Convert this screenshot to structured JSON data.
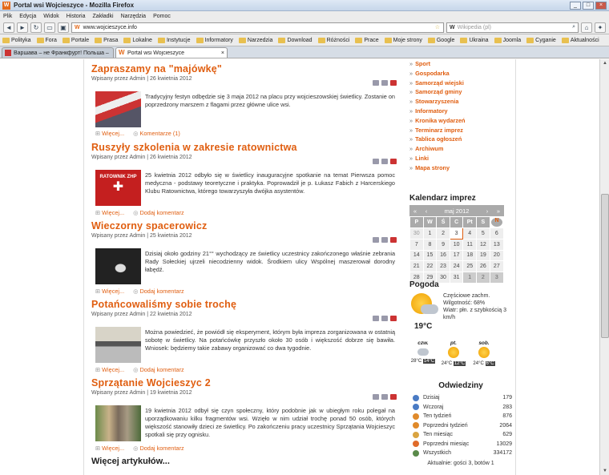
{
  "window": {
    "title": "Portal wsi Wojcieszyce - Mozilla Firefox",
    "minimize": "_",
    "maximize": "□",
    "close": "×"
  },
  "menu": [
    "Plik",
    "Edycja",
    "Widok",
    "Historia",
    "Zakładki",
    "Narzędzia",
    "Pomoc"
  ],
  "nav": {
    "back": "◄",
    "forward": "►",
    "reload": "↻",
    "home": "⌂",
    "url": "www.wojcieszyce.info",
    "search_placeholder": "Wikipedia (pl)",
    "search_engine": "W"
  },
  "bookmarks": [
    "Polityka",
    "Fora",
    "Portale",
    "Prasa",
    "Lokalne",
    "Instytucje",
    "Informatory",
    "Narzedzia",
    "Download",
    "Różności",
    "Prace",
    "Moje strony",
    "Google",
    "Ukraina",
    "Joomla",
    "Cyganie",
    "Aktualności"
  ],
  "tabs": [
    {
      "label": "Варшава – не Франкфурт! Польша – н...",
      "active": false
    },
    {
      "label": "Portal wsi Wojcieszyce",
      "active": true
    }
  ],
  "articles": [
    {
      "title": "Zapraszamy na \"majówkę\"",
      "meta": "Wpisany przez Admin | 26 kwietnia 2012",
      "body": "Tradycyjny festyn odbędzie się 3 maja 2012 na placu przy wojcieszowskiej świetlicy. Zostanie on poprzedzony marszem z flagami przez główne ulice wsi.",
      "more": "Więcej...",
      "comments": "Komentarze (1)"
    },
    {
      "title": "Ruszyły szkolenia w zakresie ratownictwa",
      "meta": "Wpisany przez Admin | 26 kwietnia 2012",
      "body": "25 kwietnia 2012 odbyło się w świetlicy inauguracyjne spotkanie na temat Pierwsza pomoc medyczna - podstawy teoretyczne i praktyka. Poprowadził je p. Łukasz Fabich z Harcerskiego Klubu Ratownictwa, którego towarzyszyła dwójka asystentów.",
      "more": "Więcej...",
      "comments": "Dodaj komentarz",
      "img_text": "RATOWNIK ZHP"
    },
    {
      "title": "Wieczorny spacerowicz",
      "meta": "Wpisany przez Admin | 25 kwietnia 2012",
      "body": "Dzisiaj około godziny 21°° wychodzący ze świetlicy uczestnicy zakończonego właśnie zebrania Rady Sołeckiej ujrzeli niecodzienny widok. Środkiem ulicy Wspólnej maszerował dorodny łabędź.",
      "more": "Więcej...",
      "comments": "Dodaj komentarz"
    },
    {
      "title": "Potańcowaliśmy sobie trochę",
      "meta": "Wpisany przez Admin | 22 kwietnia 2012",
      "body": "Można powiedzieć, że powiódł się eksperyment, którym była impreza zorganizowana w ostatnią sobotę w świetlicy. Na potańcówkę przyszło około 30 osób i większość dobrze się bawiła. Wniosek: będziemy takie zabawy organizować co dwa tygodnie.",
      "more": "Więcej...",
      "comments": "Dodaj komentarz"
    },
    {
      "title": "Sprzątanie Wojcieszyc 2",
      "meta": "Wpisany przez Admin | 19 kwietnia 2012",
      "body": "19 kwietnia 2012 odbył się czyn społeczny, który podobnie jak w ubiegłym roku polegał na uporządkowaniu kilku fragmentów wsi. Wzięło w nim udział trochę ponad 50 osób, których większość stanowiły dzieci ze świetlicy. Po zakończeniu pracy uczestnicy Sprzątania Wojcieszyc spotkali się przy ognisku.",
      "more": "Więcej...",
      "comments": "Dodaj komentarz"
    }
  ],
  "more_articles": "Więcej artykułów...",
  "categories": [
    "Sport",
    "Gospodarka",
    "Samorząd wiejski",
    "Samorząd gminy",
    "Stowarzyszenia",
    "Informatory",
    "Kronika wydarzeń",
    "Terminarz imprez",
    "Tablica ogłoszeń",
    "Archiwum",
    "Linki",
    "Mapa strony"
  ],
  "calendar": {
    "title": "Kalendarz imprez",
    "month": "maj 2012",
    "prev_year": "«",
    "prev": "‹",
    "next": "›",
    "next_year": "»",
    "days": [
      "P",
      "W",
      "Ś",
      "C",
      "Pt",
      "S",
      "N"
    ],
    "weeks": [
      [
        "30",
        "1",
        "2",
        "3",
        "4",
        "5",
        "6"
      ],
      [
        "7",
        "8",
        "9",
        "10",
        "11",
        "12",
        "13"
      ],
      [
        "14",
        "15",
        "16",
        "17",
        "18",
        "19",
        "20"
      ],
      [
        "21",
        "22",
        "23",
        "24",
        "25",
        "26",
        "27"
      ],
      [
        "28",
        "29",
        "30",
        "31",
        "1",
        "2",
        "3"
      ]
    ]
  },
  "weather": {
    "title": "Pogoda",
    "now_temp": "19°C",
    "desc": "Częściowe zachm.",
    "humidity": "Wilgotność: 68%",
    "wind": "Wiatr: płn. z szybkością 3 km/h",
    "forecast": [
      {
        "day": "czw.",
        "low": "28°C",
        "high": "14°C"
      },
      {
        "day": "pt.",
        "low": "24°C",
        "high": "12°C"
      },
      {
        "day": "sob.",
        "low": "24°C",
        "high": "6°C"
      }
    ]
  },
  "visits": {
    "title": "Odwiedziny",
    "rows": [
      {
        "label": "Dzisiaj",
        "value": "179"
      },
      {
        "label": "Wczoraj",
        "value": "283"
      },
      {
        "label": "Ten tydzień",
        "value": "876"
      },
      {
        "label": "Poprzedni tydzień",
        "value": "2064"
      },
      {
        "label": "Ten miesiąc",
        "value": "629"
      },
      {
        "label": "Poprzedni miesiąc",
        "value": "13029"
      },
      {
        "label": "Wszystkich",
        "value": "334172"
      }
    ],
    "online": "Aktualnie: gości 3, botów 1"
  }
}
